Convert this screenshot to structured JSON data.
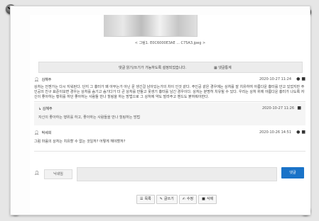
{
  "caption": "< 그림1. E0C6000E3AE ... C75A3.jpeg >",
  "notice": {
    "text": "댓글 읽기/쓰기가 가능하도록 설정되었습니다.",
    "stats_label": "댓글통계",
    "stats_icon": "table-icon"
  },
  "comments": [
    {
      "author": "김해주",
      "date": "2020-10-27 11:24",
      "body": "상처는 언젠가는 다시 지워된다. 단지 그 흉터가 왜 아무는가 아닌 문 생긴걸 남아있는가의 차이 인것 같다. 주인공 같은 경우에는 상처를 잘 치유하여 아름다운 흉터를 안고 있었지만 주인공의 친구 표준이보면 경우는 상처를 숨기고 숨기다가 더 큰 상처를 만들고 못생기 흉터를 남긴 경우이다. 상처는 분명히 치유될 수 있다. 우리는 상처 위에 아름다운 흉터가 나도록 자신이 좋아하는 행위를 하던 좋아하는 사람들 만나 힐링을 하는 방법으로 그 상처에 약도 발라주고 밴드도 붙여줘야한다."
    },
    {
      "author": "김해주",
      "date": "2020-10-27 11:26",
      "body": "자신이 좋아하는 행위를 하고, 좋아하는 사람들을 만나 힐링하는 방법"
    },
    {
      "author": "박세희",
      "date": "2020-10-26 14:51",
      "body": "그럼 마음의 상처는 치유할 수 없는 것일까? 어떻게 해야할까?"
    }
  ],
  "write": {
    "nickname_placeholder": "닉네임",
    "submit_label": "댓글"
  },
  "actions": [
    {
      "icon": "list-icon",
      "label": "목록"
    },
    {
      "icon": "pencil-icon",
      "label": "글쓰기"
    },
    {
      "icon": "edit-icon",
      "label": "수정"
    },
    {
      "icon": "trash-icon",
      "label": "삭제"
    }
  ]
}
